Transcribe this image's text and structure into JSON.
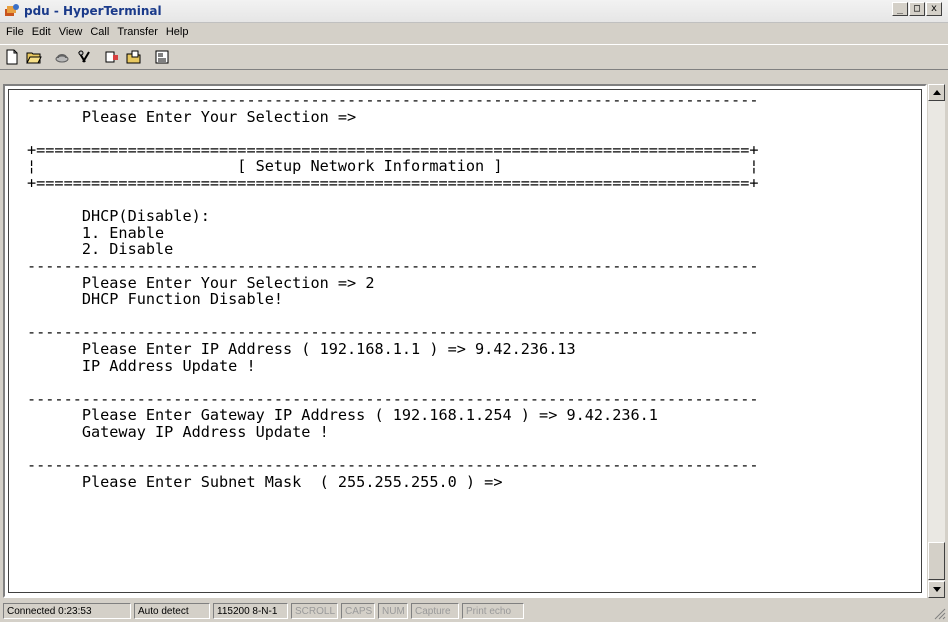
{
  "window": {
    "title": "pdu - HyperTerminal",
    "controls": [
      "_",
      "□",
      "x"
    ]
  },
  "menu": [
    "File",
    "Edit",
    "View",
    "Call",
    "Transfer",
    "Help"
  ],
  "toolbar": {
    "buttons": [
      "new-icon",
      "open-icon",
      "disconnect-icon",
      "connect-icon",
      "send-icon",
      "receive-icon",
      "properties-icon"
    ]
  },
  "terminal": {
    "lines": [
      "--------------------------------------------------------------------------------",
      "      Please Enter Your Selection =>",
      "",
      "+==============================================================================+",
      "¦                      [ Setup Network Information ]                           ¦",
      "+==============================================================================+",
      "",
      "      DHCP(Disable):",
      "      1. Enable",
      "      2. Disable",
      "--------------------------------------------------------------------------------",
      "      Please Enter Your Selection => 2",
      "      DHCP Function Disable!",
      "",
      "--------------------------------------------------------------------------------",
      "      Please Enter IP Address ( 192.168.1.1 ) => 9.42.236.13",
      "      IP Address Update !",
      "",
      "--------------------------------------------------------------------------------",
      "      Please Enter Gateway IP Address ( 192.168.1.254 ) => 9.42.236.1",
      "      Gateway IP Address Update !",
      "",
      "--------------------------------------------------------------------------------",
      "      Please Enter Subnet Mask  ( 255.255.255.0 ) =>"
    ]
  },
  "status": {
    "connected": "Connected 0:23:53",
    "detect": "Auto detect",
    "settings": "115200 8-N-1",
    "scroll": "SCROLL",
    "caps": "CAPS",
    "num": "NUM",
    "capture": "Capture",
    "print_echo": "Print echo"
  },
  "colors": {
    "title_text": "#1a3a8a",
    "chrome": "#d4d0c8",
    "terminal_bg": "#ffffff"
  }
}
